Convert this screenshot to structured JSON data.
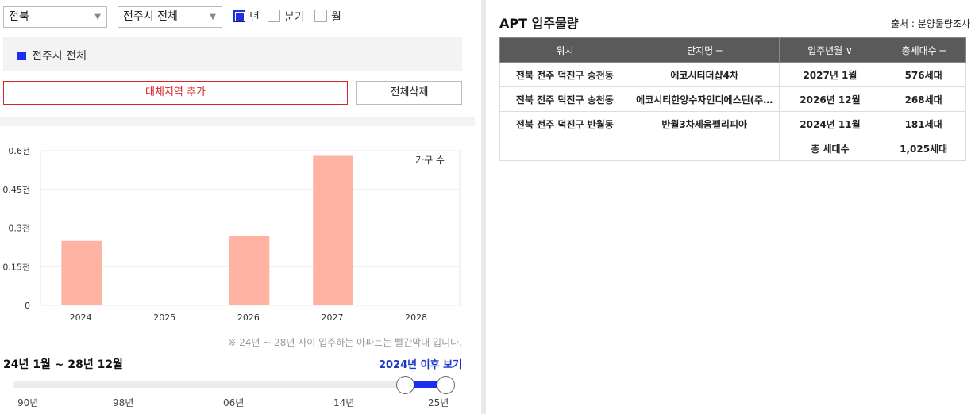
{
  "filters": {
    "province": "전북",
    "city": "전주시 전체",
    "period_options": [
      {
        "label": "년",
        "checked": true
      },
      {
        "label": "분기",
        "checked": false
      },
      {
        "label": "월",
        "checked": false
      }
    ]
  },
  "region": {
    "selected": "전주시 전체"
  },
  "buttons": {
    "add_region": "대체지역 추가",
    "delete_all": "전체삭제"
  },
  "chart_data": {
    "type": "bar",
    "categories": [
      "2024",
      "2025",
      "2026",
      "2027",
      "2028"
    ],
    "values": [
      0.25,
      0,
      0.27,
      0.58,
      0
    ],
    "ylim": [
      0,
      0.6
    ],
    "yticks": [
      "0",
      "0.15천",
      "0.3천",
      "0.45천",
      "0.6천"
    ],
    "legend": "가구 수",
    "bar_color": "#ffb3a3"
  },
  "note": "※ 24년 ~ 28년 사이 입주하는 아파트는 빨간막대 입니다.",
  "range": {
    "label": "24년 1월 ~ 28년 12월",
    "link": "2024년 이후 보기",
    "ticks": [
      "90년",
      "98년",
      "06년",
      "14년",
      "25년"
    ]
  },
  "panel": {
    "title": "APT 입주물량",
    "source": "출처 : 분양물량조사",
    "columns": [
      "위치",
      "단지명 ─",
      "입주년월 ∨",
      "총세대수 ─"
    ],
    "rows": [
      [
        "전북 전주 덕진구 송천동",
        "에코시티더샵4차",
        "2027년 1월",
        "576세대"
      ],
      [
        "전북 전주 덕진구 송천동",
        "에코시티한양수자인디에스틴(주…",
        "2026년 12월",
        "268세대"
      ],
      [
        "전북 전주 덕진구 반월동",
        "반월3차세움펠리피아",
        "2024년 11월",
        "181세대"
      ],
      [
        "",
        "",
        "총 세대수",
        "1,025세대"
      ]
    ]
  },
  "colors": {
    "accent_blue": "#1b2ff0",
    "accent_red": "#d8232a",
    "header_gray": "#5a5a5a"
  }
}
